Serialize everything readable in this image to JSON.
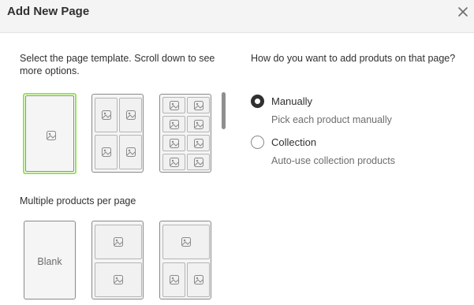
{
  "dialog": {
    "title": "Add New Page",
    "close_icon": "close-icon"
  },
  "templates": {
    "intro": "Select the page template. Scroll down to see more options.",
    "single_section_label": "Multiple products per page",
    "blank_label": "Blank",
    "placeholder_icon": "image-placeholder-icon",
    "selected_index": 0
  },
  "add_method": {
    "question": "How do you want to add produts on that page?",
    "options": [
      {
        "label": "Manually",
        "help": "Pick each product manually",
        "checked": true
      },
      {
        "label": "Collection",
        "help": "Auto-use collection products",
        "checked": false
      }
    ]
  },
  "colors": {
    "selected_border": "#9be15d",
    "radio_checked": "#303030"
  }
}
